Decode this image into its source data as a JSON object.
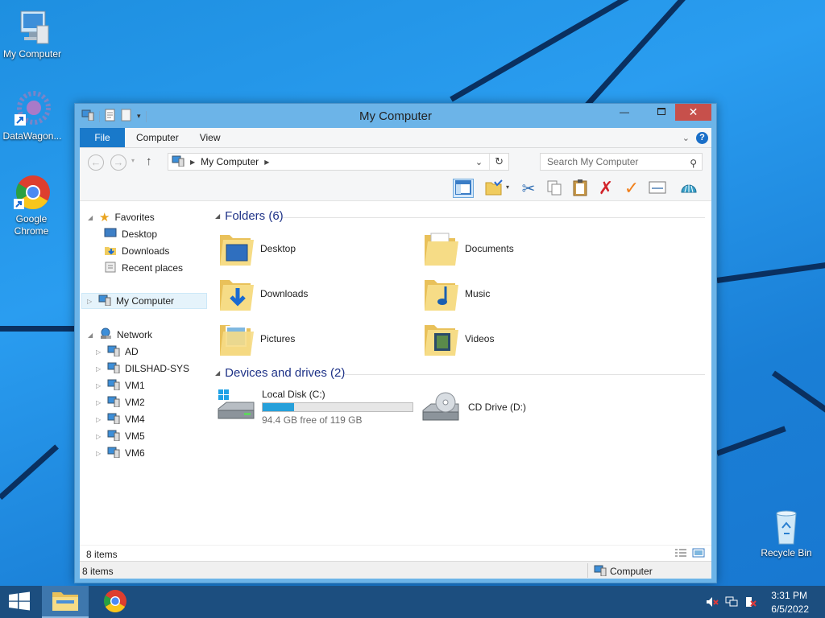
{
  "desktop": {
    "icons": [
      {
        "label": "My Computer"
      },
      {
        "label": "DataWagon..."
      },
      {
        "label": "Google Chrome"
      },
      {
        "label": "Recycle Bin"
      }
    ]
  },
  "window": {
    "title": "My Computer",
    "ribbon_tabs": [
      "File",
      "Computer",
      "View"
    ],
    "address": {
      "segment": "My Computer"
    },
    "search_placeholder": "Search My Computer",
    "navigation": {
      "favorites": {
        "label": "Favorites",
        "items": [
          "Desktop",
          "Downloads",
          "Recent places"
        ]
      },
      "computer": {
        "label": "My Computer"
      },
      "network": {
        "label": "Network",
        "items": [
          "AD",
          "DILSHAD-SYS",
          "VM1",
          "VM2",
          "VM4",
          "VM5",
          "VM6"
        ]
      }
    },
    "folders_group": {
      "label": "Folders (6)"
    },
    "folders": [
      "Desktop",
      "Documents",
      "Downloads",
      "Music",
      "Pictures",
      "Videos"
    ],
    "devices_group": {
      "label": "Devices and drives (2)"
    },
    "drives": [
      {
        "name": "Local Disk (C:)",
        "free_text": "94.4 GB free of 119 GB",
        "used_fraction": 0.21
      },
      {
        "name": "CD Drive (D:)"
      }
    ],
    "item_count": "8 items",
    "status": {
      "left": "8 items",
      "right": "Computer"
    }
  },
  "taskbar": {
    "time": "3:31 PM",
    "date": "6/5/2022"
  },
  "colors": {
    "accent": "#1979ca",
    "close": "#c7504b",
    "taskbar": "#1c4e7f"
  }
}
